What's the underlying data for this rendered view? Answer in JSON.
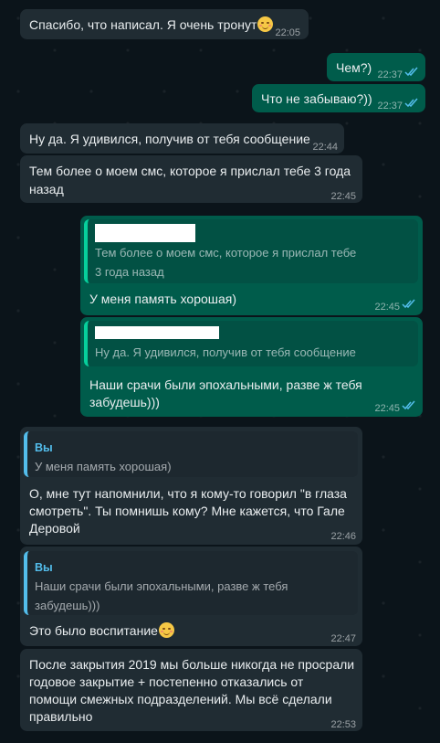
{
  "messages": [
    {
      "text": "Спасибо, что написал. Я очень тронут",
      "emoji": "touched-smile-emoji",
      "time": "22:05"
    },
    {
      "text": "Чем?)",
      "time": "22:37",
      "status": "read"
    },
    {
      "text": "Что не забываю?))",
      "time": "22:37",
      "status": "read"
    },
    {
      "text": "Ну да. Я удивился, получив от тебя сообщение",
      "time": "22:44"
    },
    {
      "text_line1": "Тем более о моем смс, которое я прислал тебе 3 года",
      "text_line2": "назад",
      "time": "22:45"
    },
    {
      "quote_line1": "Тем более о моем смс, которое я прислал тебе",
      "quote_line2": "3 года назад",
      "text": "У меня память хорошая)",
      "time": "22:45",
      "status": "read"
    },
    {
      "quote_line1": "Ну да. Я удивился, получив от тебя сообщение",
      "text_line1": "Наши срачи были эпохальными, разве ж тебя",
      "text_line2": "забудешь)))",
      "time": "22:45",
      "status": "read"
    },
    {
      "quote_author": "Вы",
      "quote_line1": "У меня память хорошая)",
      "text_line1": "О, мне тут напомнили, что я кому-то говорил \"в глаза",
      "text_line2": "смотреть\". Ты помнишь кому? Мне кажется, что Гале",
      "text_line3": "Деровой",
      "time": "22:46"
    },
    {
      "quote_author": "Вы",
      "quote_line1": "Наши срачи были эпохальными, разве ж тебя",
      "quote_line2": "забудешь)))",
      "text": "Это было воспитание",
      "emoji": "relieved-smile-emoji",
      "time": "22:47"
    },
    {
      "text_line1": "После закрытия 2019 мы больше никогда не просрали",
      "text_line2": "годовое закрытие + постепенно отказались от",
      "text_line3": "помощи смежных подразделений. Мы всё сделали",
      "text_line4": "правильно",
      "time": "22:53"
    }
  ],
  "colors": {
    "incoming": "#202c33",
    "outgoing": "#005c4b",
    "read_check": "#53bdeb",
    "background": "#0b141a"
  }
}
